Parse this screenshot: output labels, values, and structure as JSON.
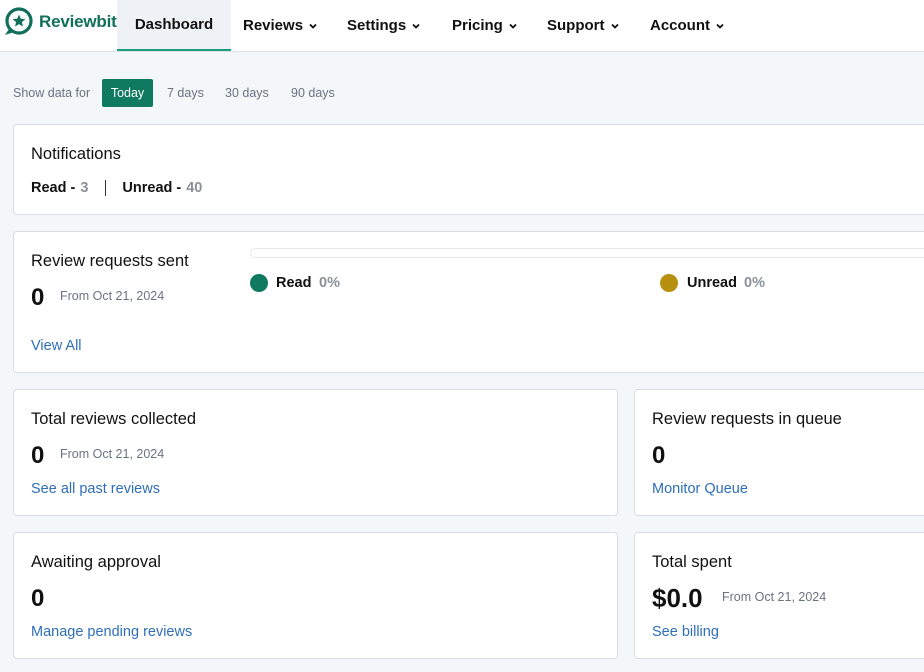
{
  "app": {
    "name": "Reviewbit",
    "brand_color": "#12705a",
    "accent": "#0f7a5f",
    "link_color": "#2f6fb8"
  },
  "nav": {
    "items": [
      {
        "label": "Dashboard",
        "active": true,
        "has_dropdown": false
      },
      {
        "label": "Reviews",
        "has_dropdown": true
      },
      {
        "label": "Settings",
        "has_dropdown": true
      },
      {
        "label": "Pricing",
        "has_dropdown": true
      },
      {
        "label": "Support",
        "has_dropdown": true
      },
      {
        "label": "Account",
        "has_dropdown": true
      }
    ]
  },
  "range": {
    "label": "Show data for",
    "options": [
      "Today",
      "7 days",
      "30 days",
      "90 days"
    ],
    "selected": "Today"
  },
  "notifications": {
    "title": "Notifications",
    "read_label": "Read -",
    "read_count": "3",
    "unread_label": "Unread -",
    "unread_count": "40"
  },
  "requests_sent": {
    "title": "Review requests sent",
    "value": "0",
    "from": "From Oct 21, 2024",
    "link": "View All",
    "read_label": "Read",
    "read_pct": "0%",
    "read_color": "#0f7a5f",
    "unread_label": "Unread",
    "unread_pct": "0%",
    "unread_color": "#b8900f",
    "progress_fraction": 0
  },
  "total_reviews": {
    "title": "Total reviews collected",
    "value": "0",
    "from": "From Oct 21, 2024",
    "link": "See all past reviews"
  },
  "queue": {
    "title": "Review requests in queue",
    "value": "0",
    "link": "Monitor Queue"
  },
  "awaiting": {
    "title": "Awaiting approval",
    "value": "0",
    "link": "Manage pending reviews"
  },
  "spent": {
    "title": "Total spent",
    "value": "$0.0",
    "from": "From Oct 21, 2024",
    "link": "See billing"
  }
}
